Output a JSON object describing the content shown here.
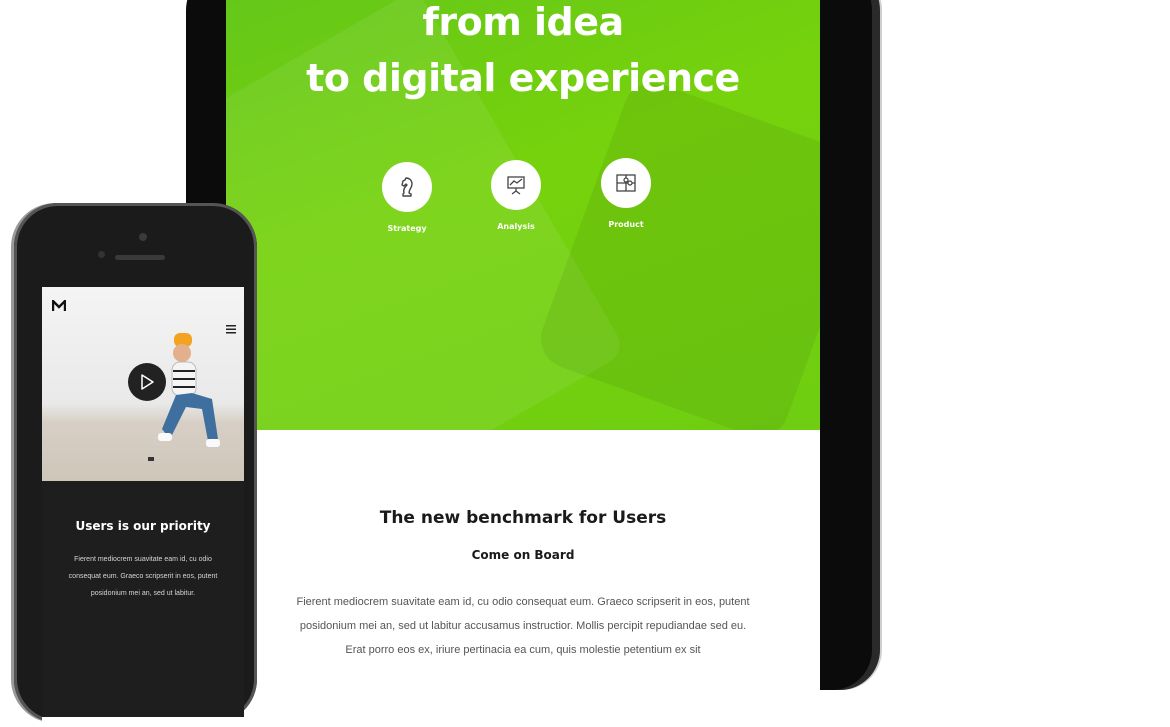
{
  "tablet": {
    "hero": {
      "title_line1": "from idea",
      "title_line2": "to digital experience",
      "features": [
        {
          "label": "Strategy",
          "icon": "chess-knight-icon"
        },
        {
          "label": "Analysis",
          "icon": "presentation-chart-icon"
        },
        {
          "label": "Product",
          "icon": "puzzle-icon"
        }
      ],
      "accent_color": "#6fcf10"
    },
    "content": {
      "title": "The new benchmark for Users",
      "subtitle": "Come on Board",
      "body": "Fierent mediocrem suavitate eam id, cu odio consequat eum. Graeco scripserit in eos, putent posidonium mei an, sed ut labitur accusamus instructior. Mollis percipit repudiandae sed eu. Erat porro eos ex, iriure pertinacia ea cum, quis molestie petentium ex sit"
    }
  },
  "phone": {
    "logo": "M",
    "title": "Users is our priority",
    "body": "Fierent mediocrem suavitate eam id, cu odio consequat eum. Graeco scripserit in eos, putent posidonium mei an, sed ut labitur."
  }
}
